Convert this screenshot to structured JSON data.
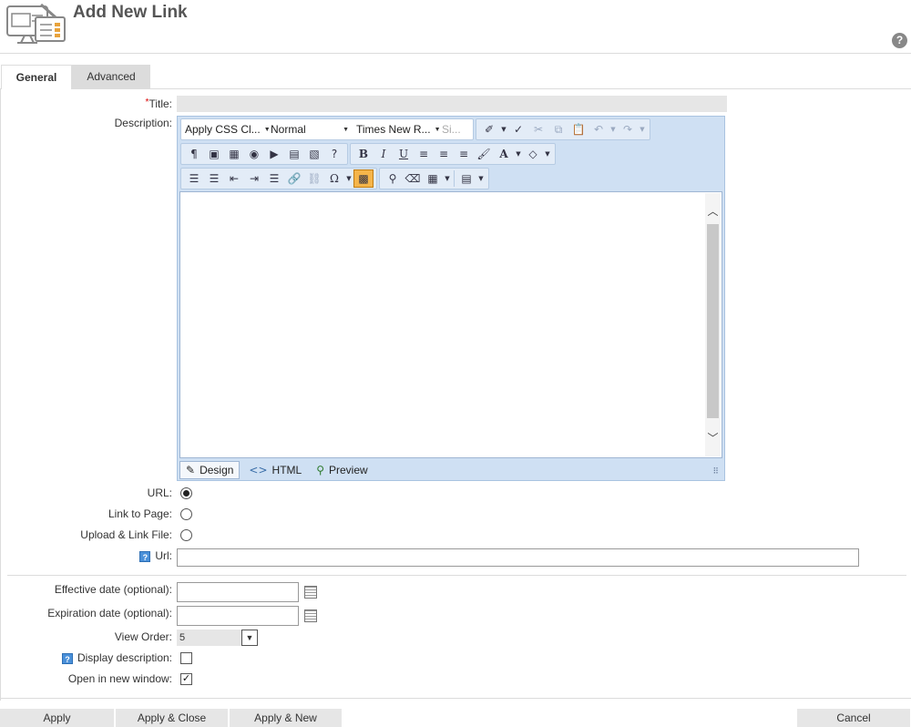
{
  "header": {
    "title": "Add New Link",
    "help_label": "?"
  },
  "tabs": [
    {
      "label": "General"
    },
    {
      "label": "Advanced"
    }
  ],
  "form": {
    "title_label": "Title:",
    "title_required_mark": "*",
    "description_label": "Description:",
    "url_radio_label": "URL:",
    "link_to_page_label": "Link to Page:",
    "upload_link_file_label": "Upload & Link File:",
    "url_field_label": "Url:",
    "link_type_selected": "URL",
    "effective_date_label": "Effective date (optional):",
    "expiration_date_label": "Expiration date (optional):",
    "view_order_label": "View Order:",
    "view_order_value": "5",
    "display_description_label": "Display description:",
    "display_description_checked": false,
    "open_new_window_label": "Open in new window:",
    "open_new_window_checked": true,
    "help_icon_label": "?"
  },
  "editor": {
    "css_class_dropdown": "Apply CSS Cl...",
    "paragraph_dropdown": "Normal",
    "font_dropdown": "Times New R...",
    "size_dropdown": "Si...",
    "modes": [
      {
        "label": "Design"
      },
      {
        "label": "HTML"
      },
      {
        "label": "Preview"
      }
    ],
    "active_mode": "Design"
  },
  "buttons": {
    "apply": "Apply",
    "apply_close": "Apply & Close",
    "apply_new": "Apply & New",
    "cancel": "Cancel"
  },
  "colors": {
    "toolbar_bg": "#cfe0f3",
    "active_tool": "#f5b54a",
    "button_bg": "#e6e6e6"
  }
}
